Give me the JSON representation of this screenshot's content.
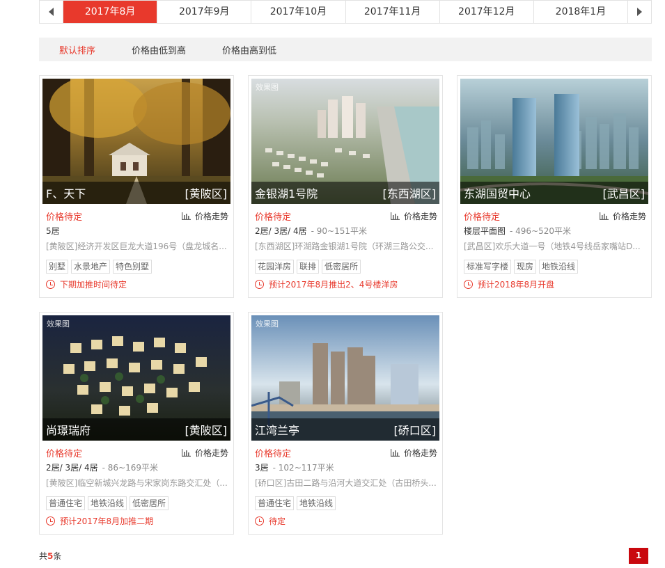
{
  "months": {
    "items": [
      "2017年8月",
      "2017年9月",
      "2017年10月",
      "2017年11月",
      "2017年12月",
      "2018年1月"
    ],
    "active_index": 0,
    "prev_icon": "chevron-left-icon",
    "next_icon": "chevron-right-icon"
  },
  "sort": {
    "default": "默认排序",
    "price_asc": "价格由低到高",
    "price_desc": "价格由高到低"
  },
  "trend_label": "价格走势",
  "colors": {
    "accent": "#e8392c",
    "page_active": "#c9080e"
  },
  "cards": [
    {
      "name": "F、天下",
      "district": "[黄陂区]",
      "tag_label": "",
      "price": "价格待定",
      "layout": "5居",
      "area": "",
      "address": "[黄陂区]经济开发区巨龙大道196号（盘龙城名...",
      "tags": [
        "别墅",
        "水景地产",
        "特色别墅"
      ],
      "status": "下期加推时间待定"
    },
    {
      "name": "金银湖1号院",
      "district": "[东西湖区]",
      "tag_label": "效果图",
      "price": "价格待定",
      "layout": "2居/ 3居/ 4居",
      "area": "- 90~151平米",
      "address": "[东西湖区]环湖路金银湖1号院（环湖三路公交...",
      "tags": [
        "花园洋房",
        "联排",
        "低密居所"
      ],
      "status": "预计2017年8月推出2、4号楼洋房"
    },
    {
      "name": "东湖国贸中心",
      "district": "[武昌区]",
      "tag_label": "",
      "price": "价格待定",
      "layout": "楼层平面图",
      "area": "- 496~520平米",
      "address": "[武昌区]欢乐大道一号（地铁4号线岳家嘴站D...",
      "tags": [
        "标准写字楼",
        "现房",
        "地铁沿线"
      ],
      "status": "预计2018年8月开盘"
    },
    {
      "name": "尚璟瑞府",
      "district": "[黄陂区]",
      "tag_label": "效果图",
      "price": "价格待定",
      "layout": "2居/ 3居/ 4居",
      "area": "- 86~169平米",
      "address": "[黄陂区]临空新城兴龙路与宋家岗东路交汇处（...",
      "tags": [
        "普通住宅",
        "地铁沿线",
        "低密居所"
      ],
      "status": "预计2017年8月加推二期"
    },
    {
      "name": "江湾兰亭",
      "district": "[硚口区]",
      "tag_label": "效果图",
      "price": "价格待定",
      "layout": "3居",
      "area": "- 102~117平米",
      "address": "[硚口区]古田二路与沿河大道交汇处（古田桥头...",
      "tags": [
        "普通住宅",
        "地铁沿线"
      ],
      "status": "待定"
    }
  ],
  "footer": {
    "total_prefix": "共",
    "total_count": "5",
    "total_suffix": "条",
    "page": "1"
  }
}
